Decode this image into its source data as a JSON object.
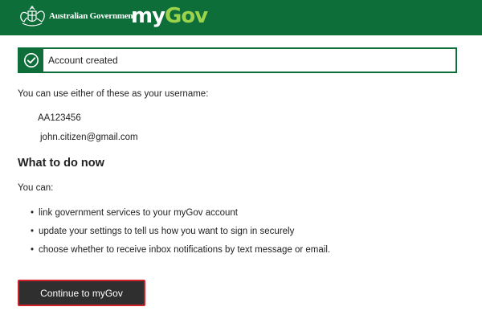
{
  "header": {
    "gov_label": "Australian Government",
    "logo_my": "my",
    "logo_gov": "Gov",
    "crest_icon": "commonwealth-crest-icon",
    "background_color": "#0e6e3a",
    "logo_accent_color": "#9bd34b"
  },
  "alert": {
    "icon": "check-circle-icon",
    "text": "Account created",
    "border_color": "#0e6e3a"
  },
  "content": {
    "intro": "You can use either of these as your username:",
    "usernames": [
      "AA123456",
      "john.citizen@gmail.com"
    ],
    "section_heading": "What to do now",
    "you_can": "You can:",
    "bullets": [
      "link government services to your myGov account",
      "update your settings to tell us how you want to sign in securely",
      "choose whether to receive inbox notifications by text message or email."
    ]
  },
  "actions": {
    "continue_label": "Continue to myGov",
    "continue_border_color": "#d0202a"
  }
}
